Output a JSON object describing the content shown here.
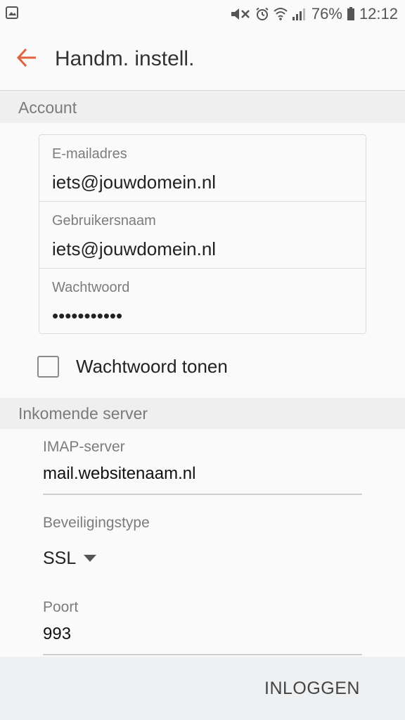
{
  "status_bar": {
    "battery": "76%",
    "time": "12:12",
    "icons": [
      "image-icon",
      "mute-icon",
      "alarm-icon",
      "wifi-icon",
      "signal-icon",
      "battery-icon"
    ]
  },
  "app_bar": {
    "back_icon": "arrow-left-icon",
    "title": "Handm. instell.",
    "accent_color": "#e2623f"
  },
  "account": {
    "section_title": "Account",
    "email": {
      "label": "E-mailadres",
      "value": "iets@jouwdomein.nl"
    },
    "username": {
      "label": "Gebruikersnaam",
      "value": "iets@jouwdomein.nl"
    },
    "password": {
      "label": "Wachtwoord",
      "value": "•••••••••••"
    },
    "show_password": {
      "label": "Wachtwoord tonen",
      "checked": false
    }
  },
  "incoming_server": {
    "section_title": "Inkomende server",
    "imap_server": {
      "label": "IMAP-server",
      "value": "mail.websitenaam.nl"
    },
    "security_type": {
      "label": "Beveiligingstype",
      "value": "SSL"
    },
    "port": {
      "label": "Poort",
      "value": "993"
    }
  },
  "footer": {
    "login_label": "INLOGGEN"
  }
}
